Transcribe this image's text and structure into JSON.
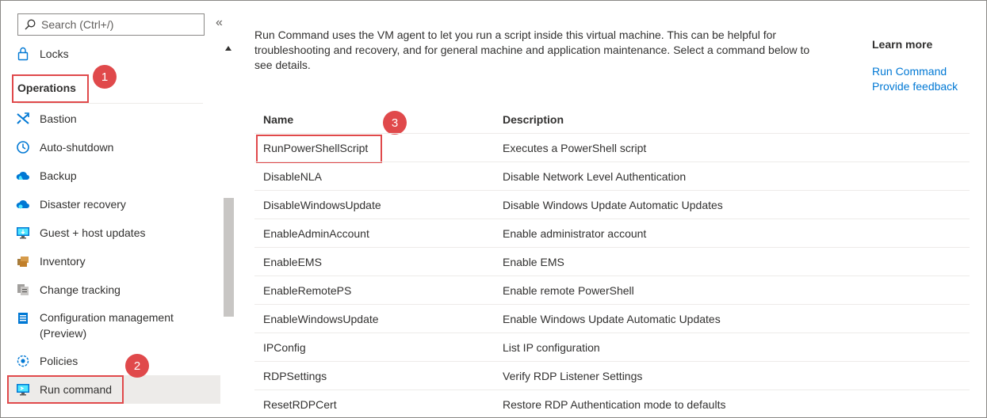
{
  "search": {
    "placeholder": "Search (Ctrl+/)"
  },
  "collapse_label": "«",
  "sidebar": {
    "locks_label": "Locks",
    "section_title": "Operations",
    "items": [
      {
        "label": "Bastion",
        "icon": "bastion-icon"
      },
      {
        "label": "Auto-shutdown",
        "icon": "clock-icon"
      },
      {
        "label": "Backup",
        "icon": "backup-cloud-icon"
      },
      {
        "label": "Disaster recovery",
        "icon": "disaster-recovery-icon"
      },
      {
        "label": "Guest + host updates",
        "icon": "updates-monitor-icon"
      },
      {
        "label": "Inventory",
        "icon": "inventory-box-icon"
      },
      {
        "label": "Change tracking",
        "icon": "change-tracking-icon"
      },
      {
        "label": "Configuration management (Preview)",
        "icon": "configuration-icon"
      },
      {
        "label": "Policies",
        "icon": "policy-gear-icon"
      },
      {
        "label": "Run command",
        "icon": "run-command-icon"
      }
    ]
  },
  "callouts": {
    "one": "1",
    "two": "2",
    "three": "3"
  },
  "main": {
    "intro": "Run Command uses the VM agent to let you run a script inside this virtual machine. This can be helpful for troubleshooting and recovery, and for general machine and application maintenance. Select a command below to see details.",
    "learn_more": {
      "title": "Learn more",
      "links": [
        "Run Command",
        "Provide feedback"
      ]
    },
    "table": {
      "columns": [
        "Name",
        "Description"
      ],
      "rows": [
        {
          "name": "RunPowerShellScript",
          "description": "Executes a PowerShell script"
        },
        {
          "name": "DisableNLA",
          "description": "Disable Network Level Authentication"
        },
        {
          "name": "DisableWindowsUpdate",
          "description": "Disable Windows Update Automatic Updates"
        },
        {
          "name": "EnableAdminAccount",
          "description": "Enable administrator account"
        },
        {
          "name": "EnableEMS",
          "description": "Enable EMS"
        },
        {
          "name": "EnableRemotePS",
          "description": "Enable remote PowerShell"
        },
        {
          "name": "EnableWindowsUpdate",
          "description": "Enable Windows Update Automatic Updates"
        },
        {
          "name": "IPConfig",
          "description": "List IP configuration"
        },
        {
          "name": "RDPSettings",
          "description": "Verify RDP Listener Settings"
        },
        {
          "name": "ResetRDPCert",
          "description": "Restore RDP Authentication mode to defaults"
        }
      ]
    }
  },
  "colors": {
    "accent": "#0078d4",
    "callout_red": "#e0494b",
    "selected_bg": "#edebe9",
    "text": "#323130"
  }
}
